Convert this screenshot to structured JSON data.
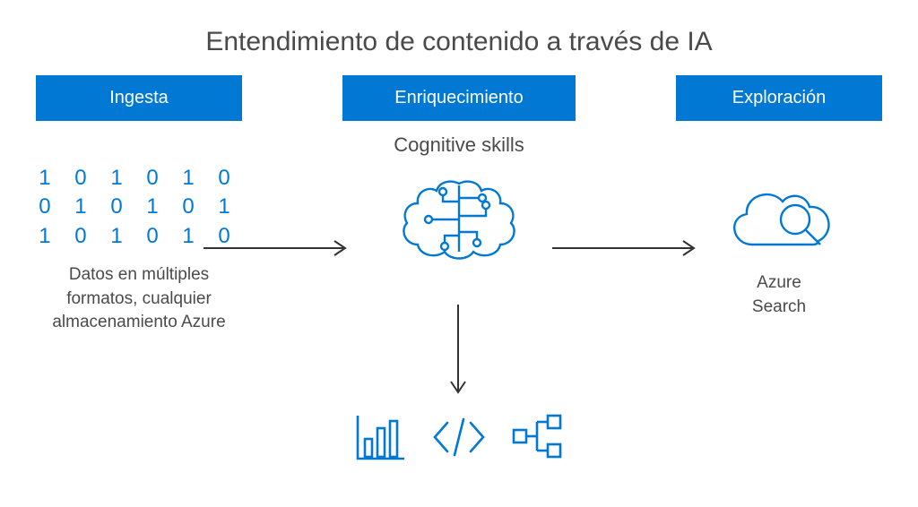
{
  "title": "Entendimiento de contenido a través de IA",
  "stages": {
    "ingest": {
      "header": "Ingesta",
      "binary_line1": "1 0 1 0 1 0",
      "binary_line2": "0 1 0 1 0 1",
      "binary_line3": "1 0 1 0 1 0",
      "description": "Datos en múltiples formatos, cualquier almacenamiento Azure"
    },
    "enrich": {
      "header": "Enriquecimiento",
      "subtitle": "Cognitive skills"
    },
    "explore": {
      "header": "Exploración",
      "description_line1": "Azure",
      "description_line2": "Search"
    }
  },
  "colors": {
    "primary": "#0078d4",
    "text": "#4a4a4a"
  },
  "icons": {
    "ingest": "binary-data-icon",
    "enrich": "brain-circuit-icon",
    "explore": "cloud-search-icon",
    "bottom": [
      "bar-chart-icon",
      "code-icon",
      "share-nodes-icon"
    ],
    "arrows": [
      "arrow-right",
      "arrow-right",
      "arrow-down"
    ]
  }
}
